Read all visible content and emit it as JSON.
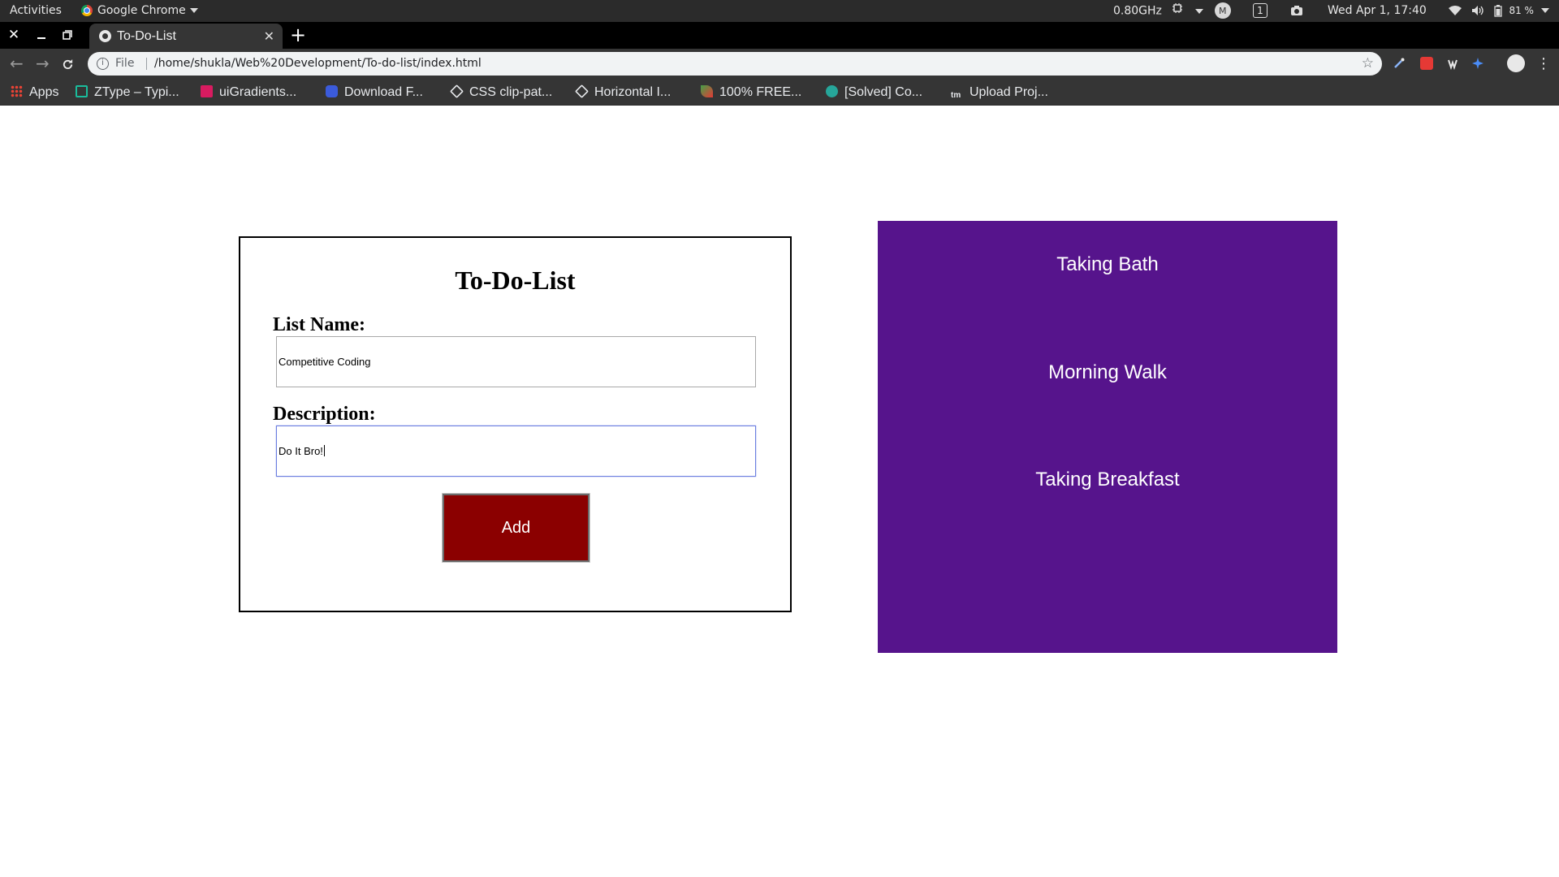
{
  "system_bar": {
    "activities": "Activities",
    "app_menu": "Google Chrome",
    "cpu_freq": "0.80GHz",
    "workspace": "1",
    "clock": "Wed Apr  1, 17:40",
    "battery": "81 %"
  },
  "browser": {
    "tab_title": "To-Do-List",
    "new_tab_label": "+",
    "omnibox": {
      "scheme_label": "File",
      "url": "/home/shukla/Web%20Development/To-do-list/index.html"
    },
    "bookmarks": [
      {
        "label": "Apps",
        "icon": "apps-grid-icon",
        "color": "#e8eaed"
      },
      {
        "label": "ZType – Typi...",
        "icon": "ztype-icon",
        "color": "#1abc9c"
      },
      {
        "label": "uiGradients...",
        "icon": "uigradients-icon",
        "color": "#d81b60"
      },
      {
        "label": "Download F...",
        "icon": "download-icon",
        "color": "#3b5bdb"
      },
      {
        "label": "CSS clip-pat...",
        "icon": "codepen-icon",
        "color": "#e8eaed"
      },
      {
        "label": "Horizontal I...",
        "icon": "codepen-icon",
        "color": "#e8eaed"
      },
      {
        "label": "100% FREE...",
        "icon": "leaf-icon",
        "color": "#43a047"
      },
      {
        "label": "[Solved] Co...",
        "icon": "github-icon",
        "color": "#26a69a"
      },
      {
        "label": "Upload Proj...",
        "icon": "tm-icon",
        "color": "#e8eaed"
      }
    ]
  },
  "form": {
    "title": "To-Do-List",
    "list_name_label": "List Name:",
    "list_name_value": "Competitive Coding",
    "description_label": "Description:",
    "description_value": "Do It Bro!",
    "add_button": "Add"
  },
  "todos": [
    {
      "label": "Taking Bath"
    },
    {
      "label": "Morning Walk"
    },
    {
      "label": "Taking Breakfast"
    }
  ],
  "colors": {
    "panel": "#56148c",
    "add_button": "#8b0000",
    "focus_ring": "#6c7fe0"
  }
}
